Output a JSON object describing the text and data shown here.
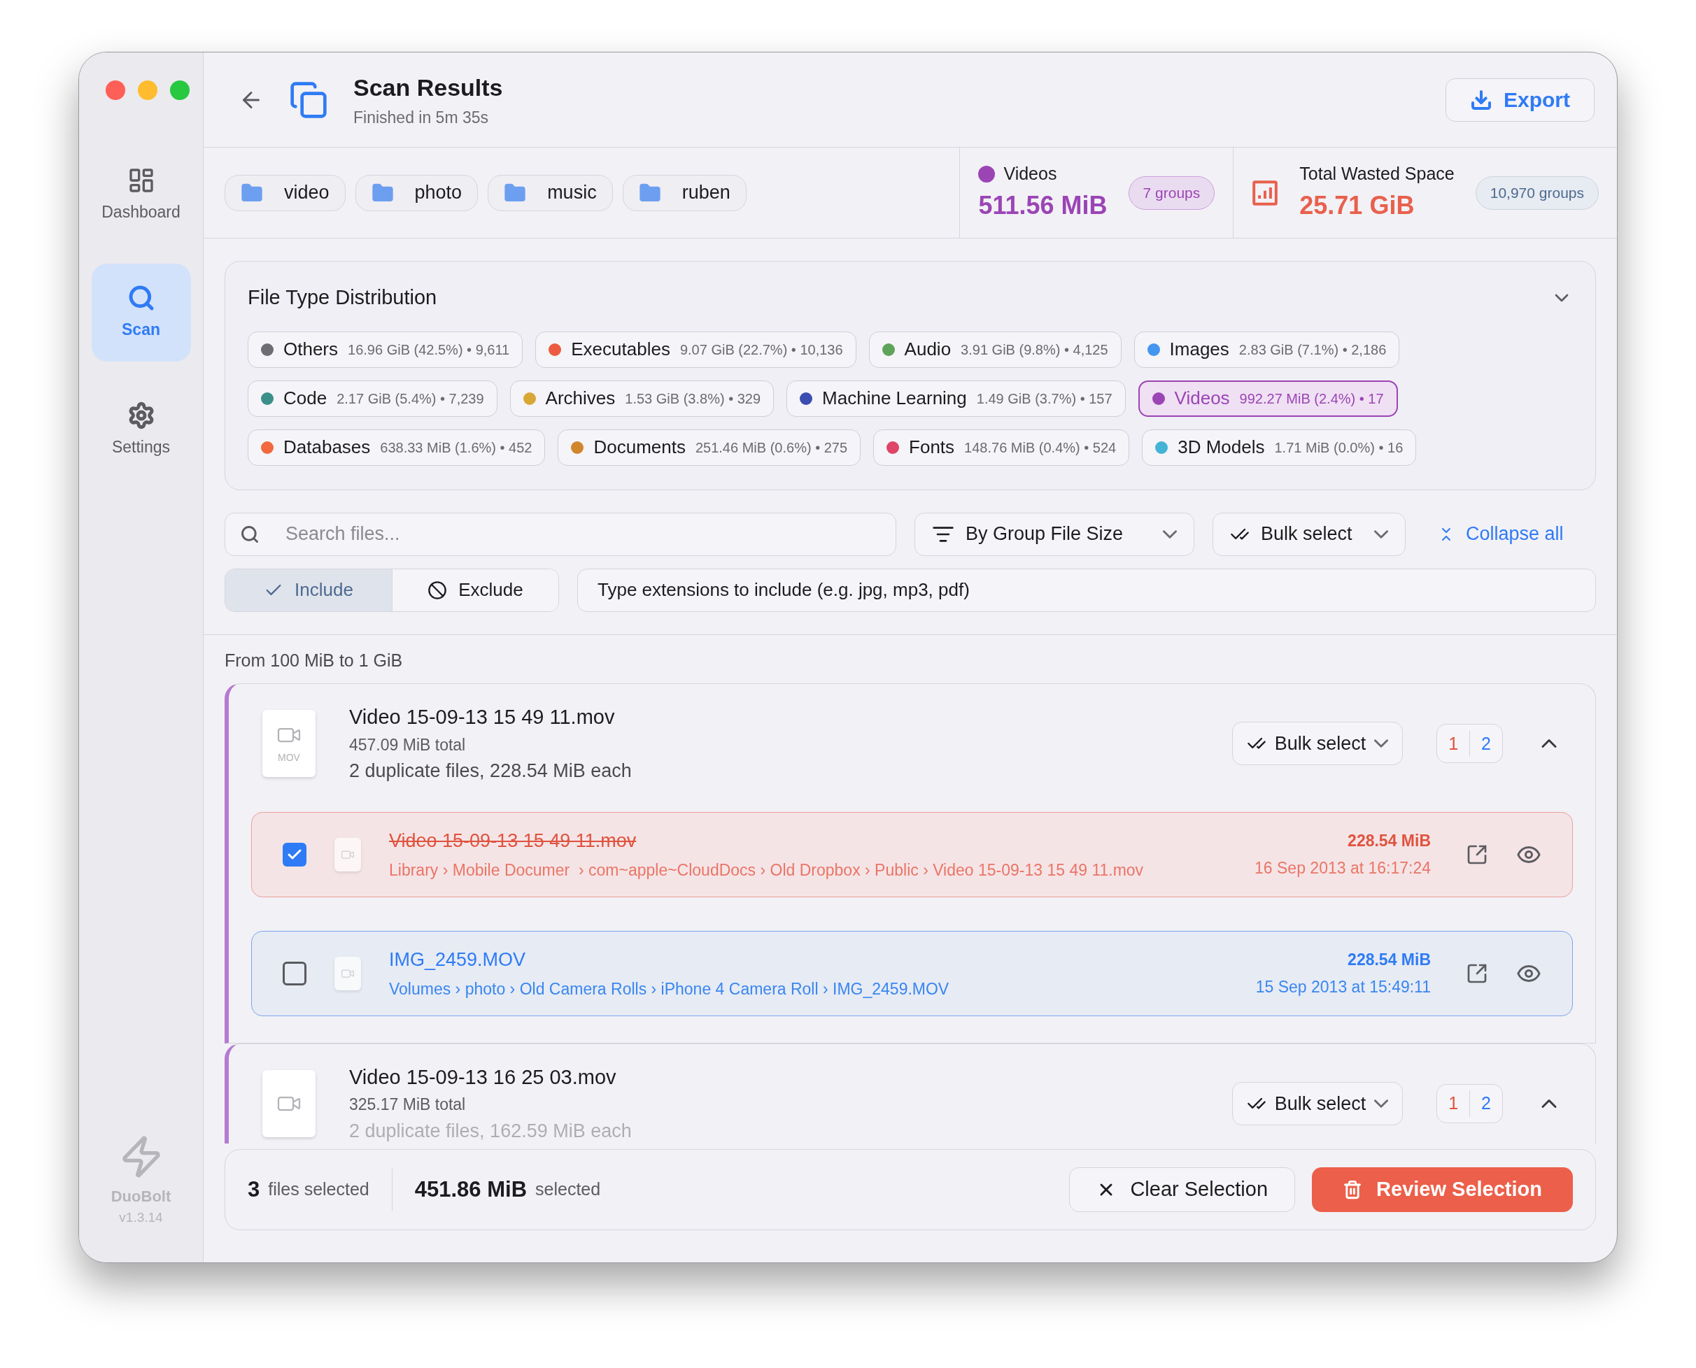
{
  "sidebar": {
    "items": [
      {
        "kind": "dashboard",
        "label": "Dashboard",
        "selected": false
      },
      {
        "kind": "scan",
        "label": "Scan",
        "selected": true
      },
      {
        "kind": "settings",
        "label": "Settings",
        "selected": false
      }
    ],
    "app_name": "DuoBolt",
    "version": "v1.3.14"
  },
  "header": {
    "title": "Scan Results",
    "subtitle": "Finished in 5m 35s",
    "export_label": "Export"
  },
  "folders": [
    "video",
    "photo",
    "music",
    "ruben"
  ],
  "stats": [
    {
      "kind": "category",
      "label": "Videos",
      "color": "#9b45b5",
      "value": "511.56 MiB",
      "badge": "7 groups"
    },
    {
      "kind": "total",
      "label": "Total Wasted Space",
      "value": "25.71 GiB",
      "badge": "10,970 groups"
    }
  ],
  "distribution": {
    "title": "File Type Distribution",
    "expanded": true,
    "items": [
      {
        "name": "Others",
        "detail": "16.96 GiB (42.5%) • 9,611",
        "color": "#6e6d73",
        "selected": false
      },
      {
        "name": "Executables",
        "detail": "9.07 GiB (22.7%) • 10,136",
        "color": "#ec5a3f",
        "selected": false
      },
      {
        "name": "Audio",
        "detail": "3.91 GiB (9.8%) • 4,125",
        "color": "#5ea35a",
        "selected": false
      },
      {
        "name": "Images",
        "detail": "2.83 GiB (7.1%) • 2,186",
        "color": "#4396f0",
        "selected": false
      },
      {
        "name": "Code",
        "detail": "2.17 GiB (5.4%) • 7,239",
        "color": "#3a8f89",
        "selected": false
      },
      {
        "name": "Archives",
        "detail": "1.53 GiB (3.8%) • 329",
        "color": "#d9a736",
        "selected": false
      },
      {
        "name": "Machine Learning",
        "detail": "1.49 GiB (3.7%) • 157",
        "color": "#3c4db0",
        "selected": false
      },
      {
        "name": "Videos",
        "detail": "992.27 MiB (2.4%) • 17",
        "color": "#9b45b5",
        "selected": true
      },
      {
        "name": "Databases",
        "detail": "638.33 MiB (1.6%) • 452",
        "color": "#f2693f",
        "selected": false
      },
      {
        "name": "Documents",
        "detail": "251.46 MiB (0.6%) • 275",
        "color": "#d1862d",
        "selected": false
      },
      {
        "name": "Fonts",
        "detail": "148.76 MiB (0.4%) • 524",
        "color": "#df4568",
        "selected": false
      },
      {
        "name": "3D Models",
        "detail": "1.71 MiB (0.0%) • 16",
        "color": "#43b3d6",
        "selected": false
      }
    ]
  },
  "toolbar": {
    "search_placeholder": "Search files...",
    "sort_label": "By Group File Size",
    "bulk_label": "Bulk select",
    "collapse_label": "Collapse all"
  },
  "filter": {
    "modes": [
      {
        "kind": "include",
        "label": "Include",
        "selected": true
      },
      {
        "kind": "exclude",
        "label": "Exclude",
        "selected": false
      }
    ],
    "extensions_placeholder": "Type extensions to include (e.g. jpg, mp3, pdf)"
  },
  "section_label": "From 100 MiB to 1 GiB",
  "groups": [
    {
      "name": "Video 15-09-13 15 49 11.mov",
      "total": "457.09 MiB total",
      "summary": "2 duplicate files, 228.54 MiB each",
      "file_type": "MOV",
      "bulk_label": "Bulk select",
      "counts": [
        "1",
        "2"
      ],
      "expanded": true,
      "files": [
        {
          "name": "Video 15-09-13 15 49 11.mov",
          "path": "Library › Mobile Documer  › com~apple~CloudDocs › Old Dropbox › Public › Video 15-09-13 15 49 11.mov",
          "size": "228.54 MiB",
          "date": "16 Sep 2013 at 16:17:24",
          "checked": true
        },
        {
          "name": "IMG_2459.MOV",
          "path": "Volumes › photo › Old Camera Rolls › iPhone 4 Camera Roll › IMG_2459.MOV",
          "size": "228.54 MiB",
          "date": "15 Sep 2013 at 15:49:11",
          "checked": false
        }
      ]
    },
    {
      "name": "Video 15-09-13 16 25 03.mov",
      "total": "325.17 MiB total",
      "summary": "2 duplicate files, 162.59 MiB each",
      "bulk_label": "Bulk select",
      "counts": [
        "1",
        "2"
      ],
      "expanded": true
    }
  ],
  "footer": {
    "count": "3",
    "count_label": "files selected",
    "size": "451.86 MiB",
    "size_label": "selected",
    "clear_label": "Clear Selection",
    "review_label": "Review Selection"
  }
}
